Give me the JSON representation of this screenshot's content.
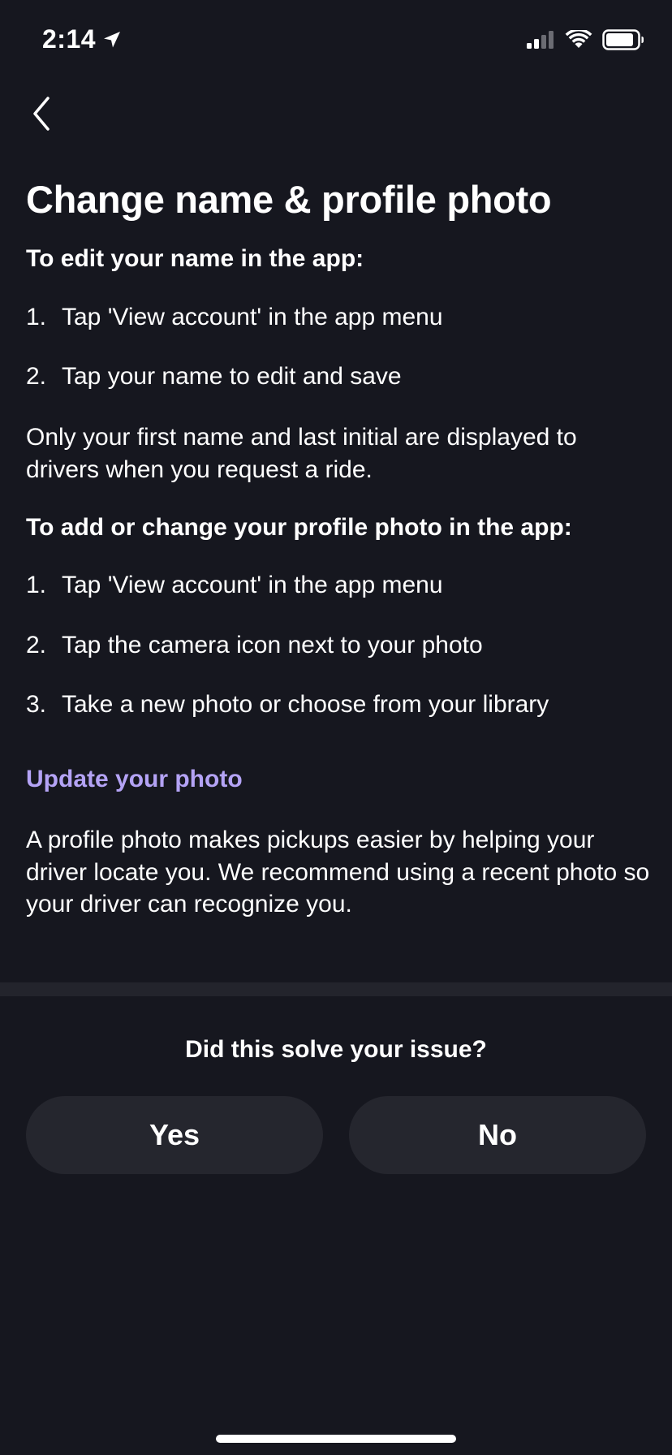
{
  "status_bar": {
    "time": "2:14",
    "location_icon": "location-arrow-icon",
    "signal_icon": "cellular-signal-icon",
    "wifi_icon": "wifi-icon",
    "battery_icon": "battery-icon"
  },
  "nav": {
    "back_icon": "chevron-left-icon"
  },
  "page": {
    "title": "Change name & profile photo",
    "name_section": {
      "heading": "To edit your name in the app:",
      "steps": [
        {
          "num": "1.",
          "text": "Tap 'View account' in the app menu"
        },
        {
          "num": "2.",
          "text": "Tap your name to edit and save"
        }
      ],
      "note": "Only your first name and last initial are displayed to drivers when you request a ride."
    },
    "photo_section": {
      "heading": "To add or change your profile photo in the app:",
      "steps": [
        {
          "num": "1.",
          "text": "Tap 'View account' in the app menu"
        },
        {
          "num": "2.",
          "text": "Tap the camera icon next to your photo"
        },
        {
          "num": "3.",
          "text": "Take a new photo or choose from your library"
        }
      ]
    },
    "update_link": "Update your photo",
    "photo_note": "A profile photo makes pickups easier by helping your driver locate you. We recommend using a recent photo so your driver can recognize you."
  },
  "feedback": {
    "question": "Did this solve your issue?",
    "yes_label": "Yes",
    "no_label": "No"
  },
  "colors": {
    "background": "#16171f",
    "link": "#b4a3f5",
    "button_bg": "#25262e",
    "divider": "#23242c"
  }
}
